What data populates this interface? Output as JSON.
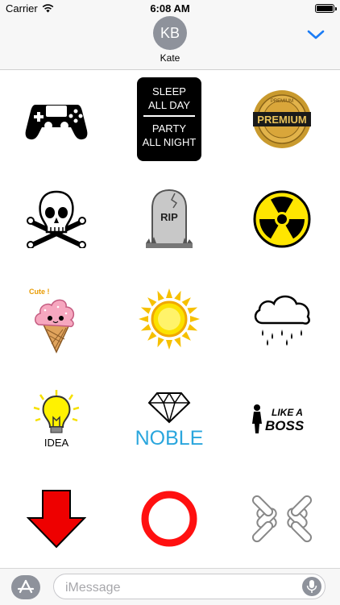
{
  "status_bar": {
    "carrier": "Carrier",
    "time": "6:08 AM",
    "battery_level": 1.0
  },
  "header": {
    "avatar_initials": "KB",
    "contact_name": "Kate",
    "collapse_icon": "chevron-down-icon",
    "accent_color": "#1b7cf5"
  },
  "stickers": [
    {
      "icon": "game-controller-icon"
    },
    {
      "icon": "sleep-party-sign",
      "lines": [
        "SLEEP",
        "ALL DAY",
        "PARTY",
        "ALL NIGHT"
      ]
    },
    {
      "icon": "premium-badge-icon",
      "text": "PREMIUM",
      "ring_text": "PREMIUM"
    },
    {
      "icon": "skull-crossbones-icon"
    },
    {
      "icon": "tombstone-icon",
      "text": "RIP"
    },
    {
      "icon": "radiation-icon"
    },
    {
      "icon": "ice-cream-icon",
      "text": "Cute !"
    },
    {
      "icon": "sun-icon"
    },
    {
      "icon": "rain-cloud-icon"
    },
    {
      "icon": "lightbulb-icon",
      "text": "IDEA"
    },
    {
      "icon": "diamond-icon",
      "text": "NOBLE"
    },
    {
      "icon": "like-a-boss-icon",
      "lines": [
        "LIKE A",
        "BOSS"
      ]
    },
    {
      "icon": "red-arrow-down-icon"
    },
    {
      "icon": "red-ring-icon"
    },
    {
      "icon": "bandage-cross-icon"
    }
  ],
  "compose_bar": {
    "apps_icon": "app-store-icon",
    "placeholder": "iMessage",
    "mic_icon": "microphone-icon"
  }
}
